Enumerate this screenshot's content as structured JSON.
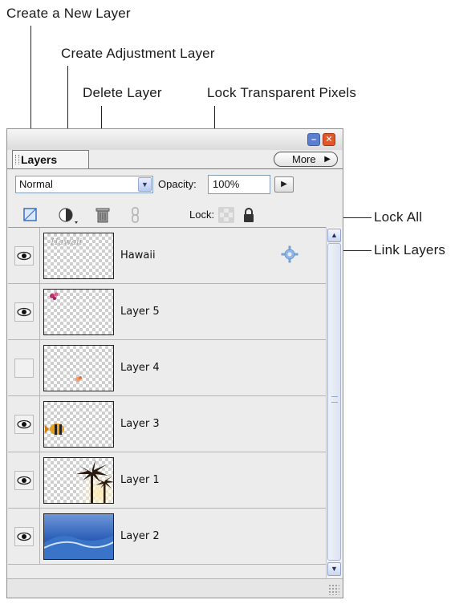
{
  "callouts": {
    "create_layer": "Create a New Layer",
    "create_adjustment": "Create Adjustment Layer",
    "delete_layer": "Delete Layer",
    "lock_transparent": "Lock Transparent Pixels",
    "lock_all": "Lock All",
    "link_layers": "Link Layers"
  },
  "panel": {
    "tab_label": "Layers",
    "more_label": "More",
    "blend_mode": "Normal",
    "opacity_label": "Opacity:",
    "opacity_value": "100%",
    "lock_label": "Lock:"
  },
  "layers": [
    {
      "name": "Hawaii",
      "visible": true,
      "icon": "layer-style-gear-icon"
    },
    {
      "name": "Layer 5",
      "visible": true
    },
    {
      "name": "Layer 4",
      "visible": false
    },
    {
      "name": "Layer 3",
      "visible": true
    },
    {
      "name": "Layer 1",
      "visible": true
    },
    {
      "name": "Layer 2",
      "visible": true
    }
  ],
  "icons": {
    "minimize": "minimize-icon",
    "close": "close-icon",
    "new_layer": "new-layer-icon",
    "adjustment": "adjustment-layer-icon",
    "delete": "trash-icon",
    "link": "link-icon",
    "lock_transparent": "lock-transparent-icon",
    "lock_all": "lock-icon",
    "eye": "eye-icon"
  },
  "colors": {
    "close_button": "#e0572a",
    "minimize_button": "#5a7fd0",
    "selection_blue": "#3a6fc4"
  }
}
